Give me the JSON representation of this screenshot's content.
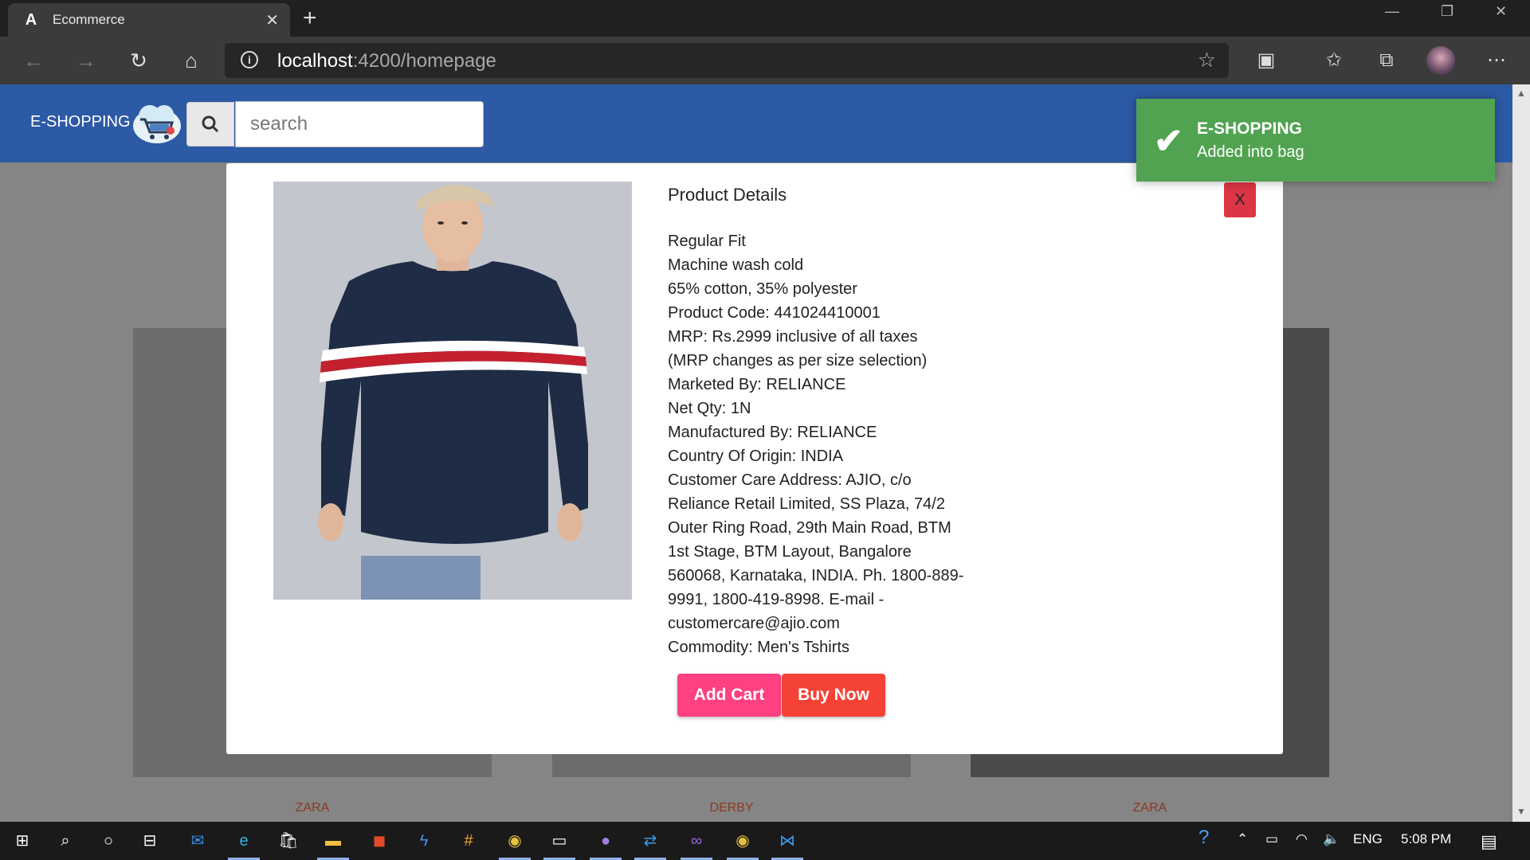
{
  "browser": {
    "tab_title": "Ecommerce",
    "tab_favicon": "A",
    "url_host": "localhost",
    "url_path": ":4200/homepage"
  },
  "header": {
    "brand": "E-SHOPPING",
    "search_placeholder": "search"
  },
  "cards": [
    {
      "brand": "ZARA"
    },
    {
      "brand": "DERBY"
    },
    {
      "brand": "ZARA"
    }
  ],
  "modal": {
    "title": "Product Details",
    "close_label": "X",
    "details": [
      "Regular Fit",
      "Machine wash cold",
      "65% cotton, 35% polyester",
      "Product Code: 441024410001",
      "MRP: Rs.2999 inclusive of all taxes",
      "(MRP changes as per size selection)",
      "Marketed By: RELIANCE",
      "Net Qty: 1N",
      "Manufactured By: RELIANCE",
      "Country Of Origin: INDIA",
      "Customer Care Address: AJIO, c/o Reliance Retail Limited, SS Plaza, 74/2 Outer Ring Road, 29th Main Road, BTM 1st Stage, BTM Layout, Bangalore 560068, Karnataka, INDIA. Ph. 1800-889-9991, 1800-419-8998. E-mail - customercare@ajio.com",
      "Commodity: Men's Tshirts"
    ],
    "add_cart_label": "Add Cart",
    "buy_now_label": "Buy Now"
  },
  "toast": {
    "title": "E-SHOPPING",
    "message": "Added into bag"
  },
  "taskbar": {
    "language": "ENG",
    "time": "5:08 PM"
  },
  "colors": {
    "header": "#2d5aa5",
    "toast": "#51a351",
    "add_cart": "#ff4081",
    "buy_now": "#f44336",
    "close": "#dc3545"
  }
}
